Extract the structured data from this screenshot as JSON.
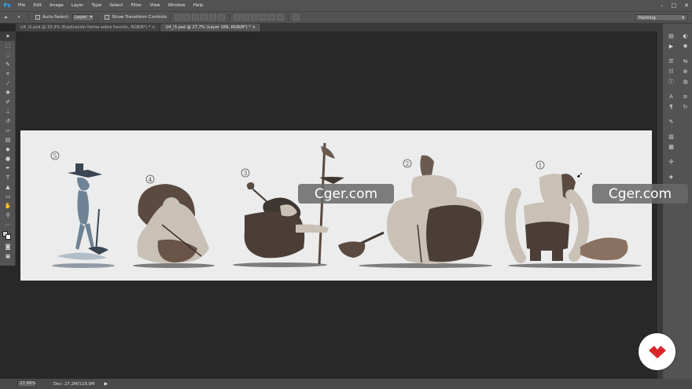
{
  "app": {
    "logo": "Ps"
  },
  "menu": [
    "File",
    "Edit",
    "Image",
    "Layer",
    "Type",
    "Select",
    "Filter",
    "View",
    "Window",
    "Help"
  ],
  "options": {
    "auto_select_label": "Auto-Select:",
    "auto_select_value": "Layer",
    "show_transform_label": "Show Transform Controls",
    "workspace": "Painting"
  },
  "tabs": [
    {
      "label": "U4_l2.psd @ 33,3% (Explicación forma sobre función, RGB/8*) *",
      "active": false
    },
    {
      "label": "U4_l3.psd @ 27,7% (Layer 166, RGB/8*) *",
      "active": true
    }
  ],
  "canvas": {
    "labels": [
      "5",
      "4",
      "3",
      "2",
      "1"
    ],
    "background": "#ececec"
  },
  "status": {
    "zoom": "27,66%",
    "doc_size": "Doc: 27,2M/119,9M"
  },
  "watermarks": [
    "Cger.com",
    "Cger.com"
  ],
  "icons": {
    "tool_icons": [
      "move-icon",
      "marquee-icon",
      "lasso-icon",
      "quick-select-icon",
      "crop-icon",
      "eyedropper-icon",
      "healing-icon",
      "brush-icon",
      "stamp-icon",
      "history-brush-icon",
      "eraser-icon",
      "gradient-icon",
      "blur-icon",
      "dodge-icon",
      "pen-icon",
      "type-icon",
      "path-select-icon",
      "shape-icon",
      "hand-icon",
      "zoom-icon"
    ]
  },
  "colors": {
    "accent": "#31a8ff",
    "brand_red": "#d9252a"
  }
}
